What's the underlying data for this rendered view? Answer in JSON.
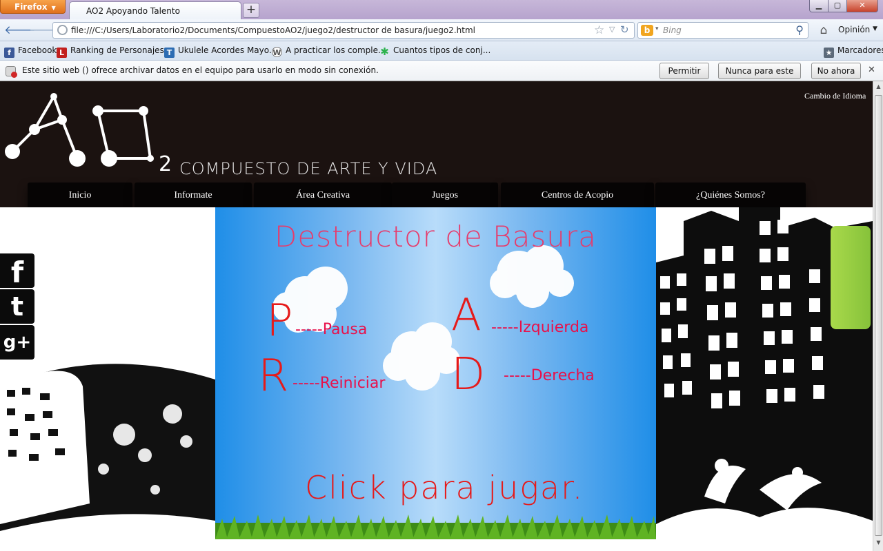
{
  "browser": {
    "app_button": "Firefox",
    "tab_title": "AO2 Apoyando Talento",
    "new_tab": "+",
    "url": "file:///C:/Users/Laboratorio2/Documents/CompuestoAO2/juego2/destructor de basura/juego2.html",
    "search_engine": "Bing",
    "search_placeholder": "Bing",
    "opinion_label": "Opinión"
  },
  "bookmarks": {
    "facebook": "Facebook",
    "ranking": "Ranking de Personajes...",
    "ukulele": "Ukulele Acordes Mayo...",
    "practicar": "A practicar los comple...",
    "tipos": "Cuantos tipos de conj...",
    "marcadores": "Marcadores"
  },
  "notification": {
    "text": "Este sitio web () ofrece archivar datos en el equipo para usarlo en modo sin conexión.",
    "allow": "Permitir",
    "never": "Nunca para este sitio",
    "not_now": "No ahora"
  },
  "site": {
    "tagline": "COMPUESTO DE ARTE Y  VIDA",
    "lang_link": "Cambio de Idioma",
    "menu": [
      "Inicio",
      "Informate",
      "Área Creativa",
      "Juegos",
      "Centros de Acopio",
      "¿Quiénes Somos?"
    ],
    "social": {
      "facebook": "f",
      "twitter": "t",
      "googleplus": "g+"
    }
  },
  "game": {
    "title": "Destructor de Basura",
    "controls": [
      {
        "key": "P",
        "desc": "-----Pausa"
      },
      {
        "key": "A",
        "desc": "-----Izquierda"
      },
      {
        "key": "R",
        "desc": "-----Reiniciar"
      },
      {
        "key": "D",
        "desc": "-----Derecha"
      }
    ],
    "play": "Click para jugar."
  },
  "colors": {
    "header_bg": "#1b1210",
    "menu_bg": "#060404",
    "game_text": "#e61a1a",
    "green_tab": "#94cc40"
  }
}
